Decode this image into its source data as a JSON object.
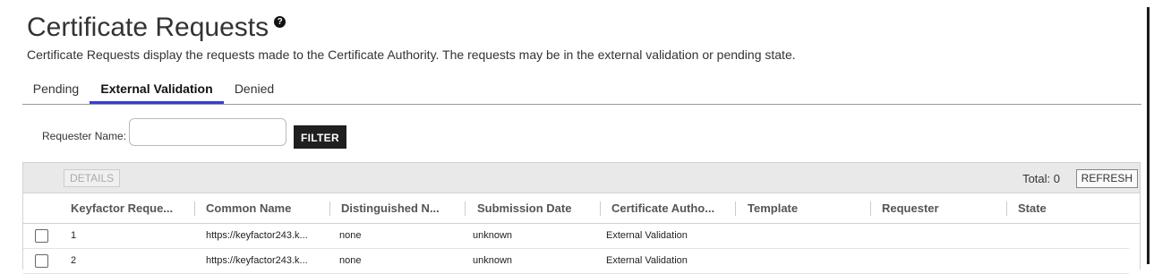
{
  "header": {
    "title": "Certificate Requests",
    "description": "Certificate Requests display the requests made to the Certificate Authority. The requests may be in the external validation or pending state."
  },
  "tabs": [
    {
      "label": "Pending",
      "active": false
    },
    {
      "label": "External Validation",
      "active": true
    },
    {
      "label": "Denied",
      "active": false
    }
  ],
  "filter": {
    "label": "Requester Name:",
    "value": "",
    "button_label": "FILTER"
  },
  "toolbar": {
    "details_label": "DETAILS",
    "total_label": "Total: 0",
    "refresh_label": "REFRESH"
  },
  "table": {
    "columns": [
      "Keyfactor Reque...",
      "Common Name",
      "Distinguished N...",
      "Submission Date",
      "Certificate Autho...",
      "Template",
      "Requester",
      "State"
    ],
    "rows": [
      {
        "id": "1",
        "common_name": "https://keyfactor243.k...",
        "dn": "none",
        "submission": "unknown",
        "ca": "External Validation",
        "template": "",
        "requester": "",
        "state": ""
      },
      {
        "id": "2",
        "common_name": "https://keyfactor243.k...",
        "dn": "none",
        "submission": "unknown",
        "ca": "External Validation",
        "template": "",
        "requester": "",
        "state": ""
      }
    ]
  },
  "colors": {
    "active_tab_underline": "#3a3ad6",
    "filter_button_bg": "#1f1f1f",
    "toolbar_bg": "#e9e9e9"
  },
  "icons": {
    "help": "question-circle"
  }
}
